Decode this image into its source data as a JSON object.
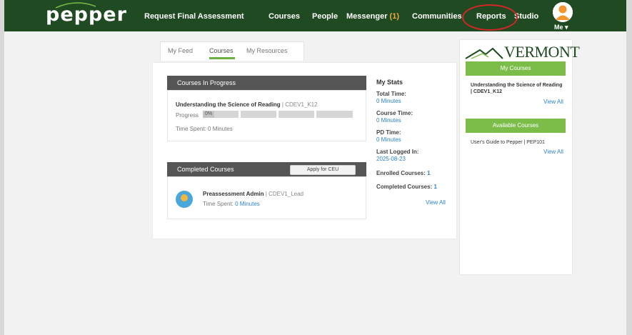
{
  "header": {
    "logo": "pepper",
    "nav": [
      {
        "label": "Request Final Assessment"
      },
      {
        "label": "Courses"
      },
      {
        "label": "People"
      },
      {
        "label": "Messenger",
        "badge": "(1)"
      },
      {
        "label": "Communities"
      },
      {
        "label": "Reports"
      },
      {
        "label": "Studio"
      }
    ],
    "me_label": "Me ▾"
  },
  "tabs": [
    {
      "label": "My Feed"
    },
    {
      "label": "Courses"
    },
    {
      "label": "My Resources"
    }
  ],
  "in_progress": {
    "header": "Courses In Progress",
    "course_title": "Understanding the Science of Reading",
    "course_code": "| CDEV1_K12",
    "progress_label": "Progress",
    "progress_value": "0%",
    "time_spent_label": "Time Spent: 0 Minutes"
  },
  "completed": {
    "header": "Completed Courses",
    "apply_button": "Apply for CEU",
    "course_title": "Preassessment Admin",
    "course_code": "| CDEV1_Lead",
    "time_spent_label": "Time Spent:",
    "time_spent_value": "0 Minutes"
  },
  "stats": {
    "title": "My Stats",
    "total_time_label": "Total Time:",
    "total_time_value": "0 Minutes",
    "course_time_label": "Course Time:",
    "course_time_value": "0 Minutes",
    "pd_time_label": "PD Time:",
    "pd_time_value": "0 Minutes",
    "last_logged_label": "Last Logged In:",
    "last_logged_value": "2025-08-23",
    "enrolled_label": "Enrolled Courses:",
    "enrolled_value": "1",
    "completed_label": "Completed Courses:",
    "completed_value": "1",
    "view_all": "View All"
  },
  "right_panel": {
    "logo_text": "VERMONT",
    "my_courses_header": "My Courses",
    "my_course_item": "Understanding the Science of Reading | CDEV1_K12",
    "view_all_1": "View All",
    "available_header": "Available Courses",
    "available_item": "User's Guide to Pepper | PEP101",
    "view_all_2": "View All"
  },
  "colors": {
    "header_bg": "#1f4a22",
    "accent_green": "#7cbd4a",
    "link_blue": "#2f83c7",
    "highlight_red": "#d32626"
  }
}
